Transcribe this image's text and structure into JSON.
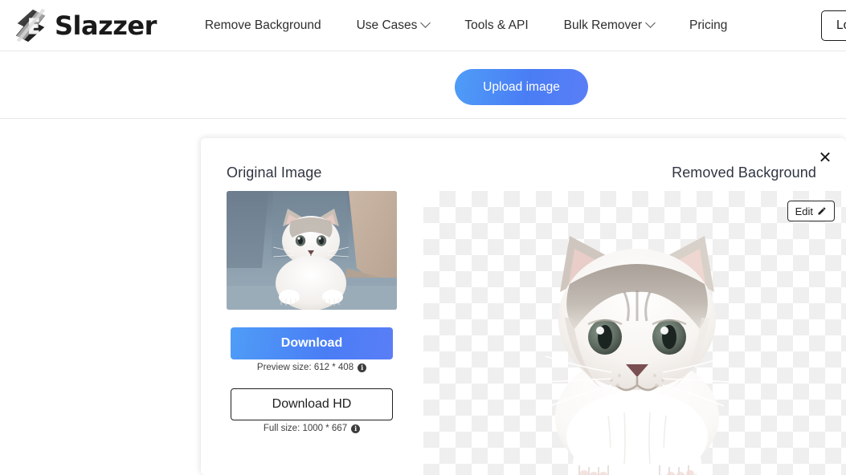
{
  "header": {
    "logo_text": "Slazzer",
    "logo_icon": "slazzer-logo-icon",
    "nav": [
      {
        "label": "Remove Background",
        "has_caret": false
      },
      {
        "label": "Use Cases",
        "has_caret": true
      },
      {
        "label": "Tools & API",
        "has_caret": false
      },
      {
        "label": "Bulk Remover",
        "has_caret": true
      },
      {
        "label": "Pricing",
        "has_caret": false
      }
    ],
    "login_label": "Login"
  },
  "upload": {
    "button_label": "Upload image"
  },
  "result": {
    "original_title": "Original Image",
    "removed_title": "Removed Background",
    "close_label": "✕",
    "edit_label": "Edit",
    "edit_icon": "pencil-icon",
    "download_label": "Download",
    "download_hd_label": "Download HD",
    "preview_size_label": "Preview size: 612 * 408",
    "full_size_label": "Full size: 1000 * 667",
    "info_glyph": "i",
    "original_image_alt": "kitten-on-couch-photo",
    "cutout_image_alt": "kitten-cutout-transparent"
  },
  "colors": {
    "accent_blue": "#4a7df5",
    "accent_blue_light": "#4f9df7",
    "text_dark": "#1f1f1f",
    "title_gray": "#2f3542",
    "border_gray": "#e8e8e8",
    "checker_gray": "#efefef"
  }
}
